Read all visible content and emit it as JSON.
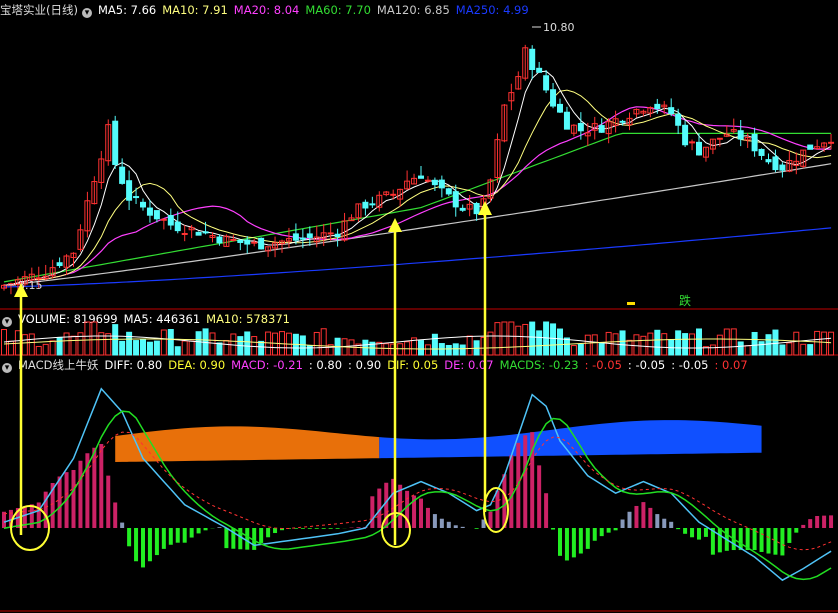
{
  "colors": {
    "bg": "#000000",
    "up": "#ff3232",
    "down": "#54fcfc",
    "ma5": "#ffffff",
    "ma10": "#ffff80",
    "ma20": "#ff40ff",
    "ma60": "#33dd33",
    "ma120": "#c8c8c8",
    "ma250": "#1a3aff",
    "diff": "#4fc3f7",
    "dea": "#22dd22",
    "macd_pos": "#cc2266",
    "macd_neg": "#22ee22",
    "macd_fade": "#8899bb",
    "band_orange": "#e8700a",
    "band_blue": "#1050ff",
    "arrow": "#ffff33",
    "separator": "#c00000"
  },
  "price_panel": {
    "title": "宝塔实业(日线)",
    "indicators": [
      {
        "label": "MA5: 7.66",
        "color": "#ffffff"
      },
      {
        "label": "MA10: 7.91",
        "color": "#ffff80"
      },
      {
        "label": "MA20: 8.04",
        "color": "#ff40ff"
      },
      {
        "label": "MA60: 7.70",
        "color": "#33dd33"
      },
      {
        "label": "MA120: 6.85",
        "color": "#c8c8c8"
      },
      {
        "label": "MA250: 4.99",
        "color": "#1a3aff"
      }
    ],
    "high_label": "10.80",
    "low_label": "3.15",
    "signal_text": "跌"
  },
  "volume_panel": {
    "indicators": [
      {
        "label": "VOLUME: 819699",
        "color": "#ffffff"
      },
      {
        "label": "MA5: 446361",
        "color": "#ffffff"
      },
      {
        "label": "MA10: 578371",
        "color": "#ffff80"
      }
    ]
  },
  "macd_panel": {
    "title": "MACD线上牛妖",
    "indicators": [
      {
        "label": "DIFF: 0.80",
        "color": "#ffffff"
      },
      {
        "label": "DEA: 0.90",
        "color": "#ffff33"
      },
      {
        "label": "MACD: -0.21",
        "color": "#ff40ff"
      },
      {
        "label": ": 0.80",
        "color": "#ffffff"
      },
      {
        "label": ": 0.90",
        "color": "#ffffff"
      },
      {
        "label": "DIF: 0.05",
        "color": "#ffff33"
      },
      {
        "label": "DE: 0.07",
        "color": "#ff40ff"
      },
      {
        "label": "MACDS: -0.23",
        "color": "#33dd33"
      },
      {
        "label": ": -0.05",
        "color": "#ff3232"
      },
      {
        "label": ": -0.05",
        "color": "#ffffff"
      },
      {
        "label": ": -0.05",
        "color": "#ffffff"
      },
      {
        "label": ": 0.07",
        "color": "#ff3232"
      }
    ]
  },
  "chart_data": {
    "type": "candlestick",
    "title": "宝塔实业(日线)",
    "price_range": [
      3.15,
      10.8
    ],
    "bars": 120
  }
}
